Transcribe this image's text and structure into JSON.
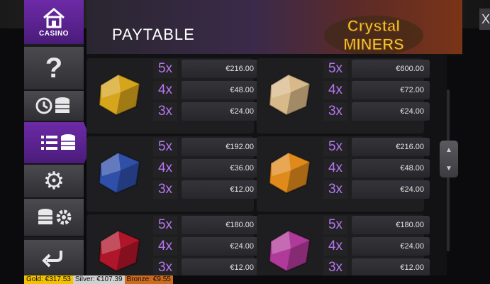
{
  "nav": {
    "casino_label": "CASINO",
    "items": [
      {
        "name": "help-button",
        "icon": "question-icon"
      },
      {
        "name": "history-button",
        "icon": "history-coins-icon"
      },
      {
        "name": "paytable-button",
        "icon": "paytable-coins-icon",
        "active": true
      },
      {
        "name": "settings-button",
        "icon": "gear-icon"
      },
      {
        "name": "bet-settings-button",
        "icon": "coins-gear-icon"
      },
      {
        "name": "back-button",
        "icon": "return-arrow-icon"
      }
    ]
  },
  "header": {
    "title": "PAYTABLE",
    "logo_line1": "Crystal",
    "logo_line2": "MINERS"
  },
  "close_label": "X",
  "paytable": [
    {
      "gem": "gold-ore-icon",
      "color": "#d6a51c",
      "rows": [
        {
          "mult": "5x",
          "pay": ""
        },
        {
          "mult": "4x",
          "pay": "€48.00"
        },
        {
          "mult": "3x",
          "pay": "€24.00"
        }
      ],
      "top_pay": "€216.00"
    },
    {
      "gem": "quartz-crystal-icon",
      "color": "#d8b98a",
      "rows": [
        {
          "mult": "5x",
          "pay": ""
        },
        {
          "mult": "4x",
          "pay": "€72.00"
        },
        {
          "mult": "3x",
          "pay": "€24.00"
        }
      ],
      "top_pay": "€600.00"
    },
    {
      "gem": "sapphire-icon",
      "color": "#2f4fa8",
      "rows": [
        {
          "mult": "5x",
          "pay": "€192.00"
        },
        {
          "mult": "4x",
          "pay": "€36.00"
        },
        {
          "mult": "3x",
          "pay": "€12.00"
        }
      ]
    },
    {
      "gem": "amber-icon",
      "color": "#e08a1c",
      "rows": [
        {
          "mult": "5x",
          "pay": "€216.00"
        },
        {
          "mult": "4x",
          "pay": "€48.00"
        },
        {
          "mult": "3x",
          "pay": "€24.00"
        }
      ]
    },
    {
      "gem": "ruby-icon",
      "color": "#b0162a",
      "rows": [
        {
          "mult": "5x",
          "pay": "€180.00"
        },
        {
          "mult": "4x",
          "pay": "€24.00"
        },
        {
          "mult": "3x",
          "pay": "€12.00"
        }
      ]
    },
    {
      "gem": "amethyst-icon",
      "color": "#b03a9a",
      "rows": [
        {
          "mult": "5x",
          "pay": "€180.00"
        },
        {
          "mult": "4x",
          "pay": "€24.00"
        },
        {
          "mult": "3x",
          "pay": "€12.00"
        }
      ]
    }
  ],
  "status": {
    "gold": "Gold: €317.53",
    "silver": "Silver: €107.39",
    "bronze": "Bronze: €9.55"
  },
  "scroll": {
    "up": "▲",
    "down": "▼"
  }
}
